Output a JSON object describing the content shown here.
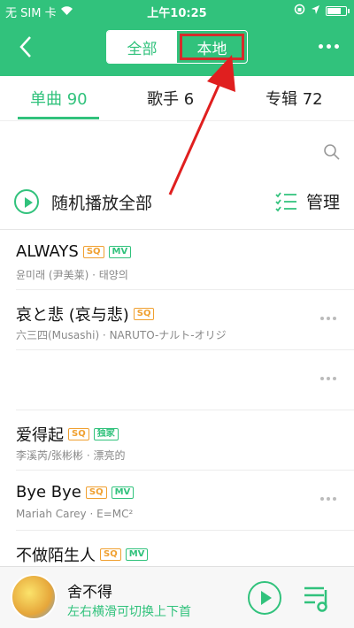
{
  "status_bar": {
    "carrier": "无 SIM 卡",
    "time": "上午10:25"
  },
  "header": {
    "segment_all": "全部",
    "segment_local": "本地"
  },
  "tabs": [
    {
      "label": "单曲 90"
    },
    {
      "label": "歌手 6"
    },
    {
      "label": "专辑 72"
    }
  ],
  "actions": {
    "shuffle_label": "随机播放全部",
    "manage_label": "管理"
  },
  "songs": [
    {
      "title": "ALWAYS",
      "badges": [
        "SQ",
        "MV"
      ],
      "subtitle": "윤미래 (尹美莱) · 태양의"
    },
    {
      "title": "哀と悲 (哀与悲)",
      "badges": [
        "SQ"
      ],
      "subtitle": "六三四(Musashi) · NARUTO-ナルト-オリジ"
    },
    {
      "title": "",
      "badges": [],
      "subtitle": ""
    },
    {
      "title": "爱得起",
      "badges": [
        "SQ",
        "独家"
      ],
      "subtitle": "李溪芮/张彬彬 · 漂亮的"
    },
    {
      "title": "Bye Bye",
      "badges": [
        "SQ",
        "MV"
      ],
      "subtitle": "Mariah Carey · E=MC²"
    },
    {
      "title": "不做陌生人",
      "badges": [
        "SQ",
        "MV"
      ],
      "subtitle": ""
    }
  ],
  "player": {
    "title": "舍不得",
    "hint": "左右横滑可切换上下首"
  },
  "colors": {
    "accent": "#31c27c",
    "sq": "#f0a030",
    "highlight_box": "#d52b2b"
  }
}
